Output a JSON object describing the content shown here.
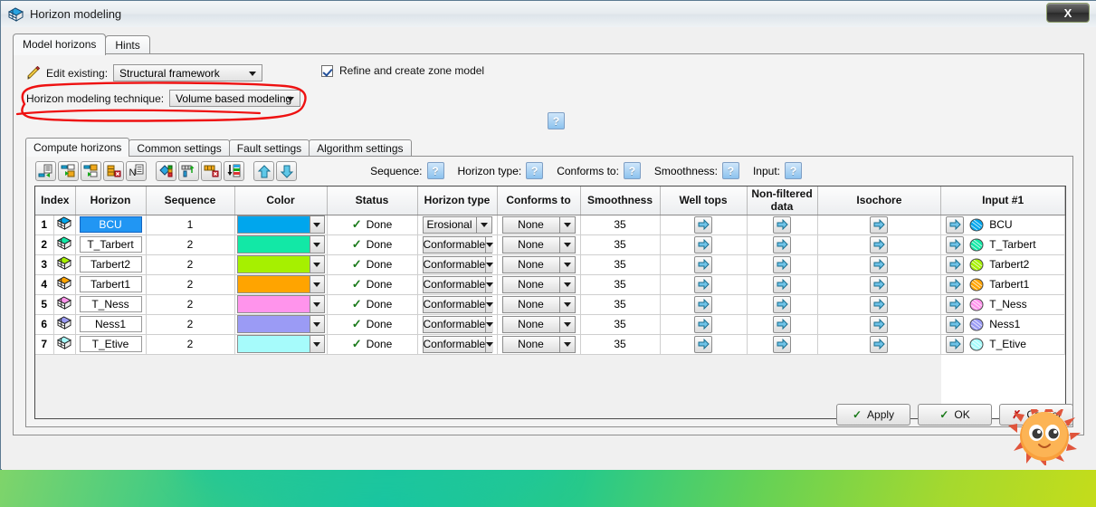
{
  "window": {
    "title": "Horizon modeling",
    "icon": "horizon-grid-icon",
    "close_label": "X"
  },
  "tabs": [
    {
      "label": "Model horizons",
      "active": true
    },
    {
      "label": "Hints",
      "active": false
    }
  ],
  "edit_existing": {
    "label": "Edit existing:",
    "icon": "pencil-icon",
    "value": "Structural framework"
  },
  "technique": {
    "label": "Horizon modeling technique:",
    "value": "Volume based modeling"
  },
  "refine": {
    "label": "Refine and create zone model",
    "checked": true,
    "help_label": "?"
  },
  "inner_tabs": [
    {
      "label": "Compute horizons",
      "active": true
    },
    {
      "label": "Common settings",
      "active": false
    },
    {
      "label": "Fault settings",
      "active": false
    },
    {
      "label": "Algorithm settings",
      "active": false
    }
  ],
  "toolbar": [
    {
      "name": "insert-horizon-button"
    },
    {
      "name": "insert-above-button"
    },
    {
      "name": "insert-below-button"
    },
    {
      "name": "delete-horizon-button"
    },
    {
      "name": "rename-n-button"
    },
    {
      "name": "fill-color-button"
    },
    {
      "name": "add-column-button"
    },
    {
      "name": "delete-column-button"
    },
    {
      "name": "sort-column-button"
    },
    {
      "name": "move-up-button"
    },
    {
      "name": "move-down-button"
    }
  ],
  "help_row": [
    {
      "label": "Sequence:",
      "help": "?"
    },
    {
      "label": "Horizon type:",
      "help": "?"
    },
    {
      "label": "Conforms to:",
      "help": "?"
    },
    {
      "label": "Smoothness:",
      "help": "?"
    },
    {
      "label": "Input:",
      "help": "?"
    }
  ],
  "grid": {
    "headers": [
      "Index",
      "Horizon",
      "Sequence",
      "Color",
      "Status",
      "Horizon type",
      "Conforms to",
      "Smoothness",
      "Well tops",
      "Non-filtered data",
      "Isochore",
      "Input #1"
    ],
    "rows": [
      {
        "index": "1",
        "horizon": "BCU",
        "selected": true,
        "sequence": "1",
        "color": "#00a6ed",
        "status": "Done",
        "horizon_type": "Erosional",
        "conforms_to": "None",
        "smoothness": "35",
        "input": "BCU"
      },
      {
        "index": "2",
        "horizon": "T_Tarbert",
        "selected": false,
        "sequence": "2",
        "color": "#12e8a6",
        "status": "Done",
        "horizon_type": "Conformable",
        "conforms_to": "None",
        "smoothness": "35",
        "input": "T_Tarbert"
      },
      {
        "index": "3",
        "horizon": "Tarbert2",
        "selected": false,
        "sequence": "2",
        "color": "#a6f000",
        "status": "Done",
        "horizon_type": "Conformable",
        "conforms_to": "None",
        "smoothness": "35",
        "input": "Tarbert2"
      },
      {
        "index": "4",
        "horizon": "Tarbert1",
        "selected": false,
        "sequence": "2",
        "color": "#ffa400",
        "status": "Done",
        "horizon_type": "Conformable",
        "conforms_to": "None",
        "smoothness": "35",
        "input": "Tarbert1"
      },
      {
        "index": "5",
        "horizon": "T_Ness",
        "selected": false,
        "sequence": "2",
        "color": "#ff94ec",
        "status": "Done",
        "horizon_type": "Conformable",
        "conforms_to": "None",
        "smoothness": "35",
        "input": "T_Ness"
      },
      {
        "index": "6",
        "horizon": "Ness1",
        "selected": false,
        "sequence": "2",
        "color": "#9b9bf5",
        "status": "Done",
        "horizon_type": "Conformable",
        "conforms_to": "None",
        "smoothness": "35",
        "input": "Ness1"
      },
      {
        "index": "7",
        "horizon": "T_Etive",
        "selected": false,
        "sequence": "2",
        "color": "#a6fbfb",
        "status": "Done",
        "horizon_type": "Conformable",
        "conforms_to": "None",
        "smoothness": "35",
        "input": "T_Etive"
      }
    ]
  },
  "buttons": {
    "apply": "Apply",
    "ok": "OK",
    "cancel": "Cancel"
  },
  "colors": {
    "selection": "#2196f3",
    "status_tick": "#1a7a1a",
    "cancel_x": "#c01717",
    "annotation": "#ee1111",
    "help_blue": "#8cc2ee"
  }
}
